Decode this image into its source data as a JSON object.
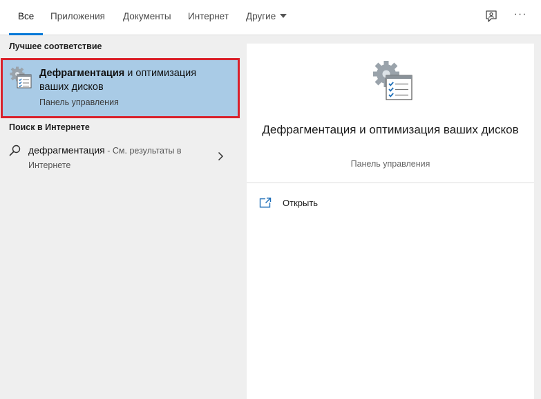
{
  "tabs": {
    "all": "Все",
    "apps": "Приложения",
    "documents": "Документы",
    "web": "Интернет",
    "other": "Другие"
  },
  "toolbar": {
    "feedback_icon": "feedback-icon",
    "more": "···"
  },
  "results": {
    "best_match_heading": "Лучшее соответствие",
    "best_match": {
      "title_bold": "Дефрагментация",
      "title_rest": " и оптимизация ваших дисков",
      "subtitle": "Панель управления",
      "icon": "defrag-tool-icon"
    },
    "web_heading": "Поиск в Интернете",
    "web_item": {
      "query": "дефрагментация",
      "hint_line1": " - См. результаты в",
      "hint_line2": "Интернете"
    }
  },
  "preview": {
    "title": "Дефрагментация и оптимизация ваших дисков",
    "subtitle": "Панель управления",
    "actions": {
      "open": "Открыть"
    }
  },
  "colors": {
    "accent": "#0078d7",
    "selection": "#a9cbe6",
    "highlight_border": "#d9202a"
  }
}
